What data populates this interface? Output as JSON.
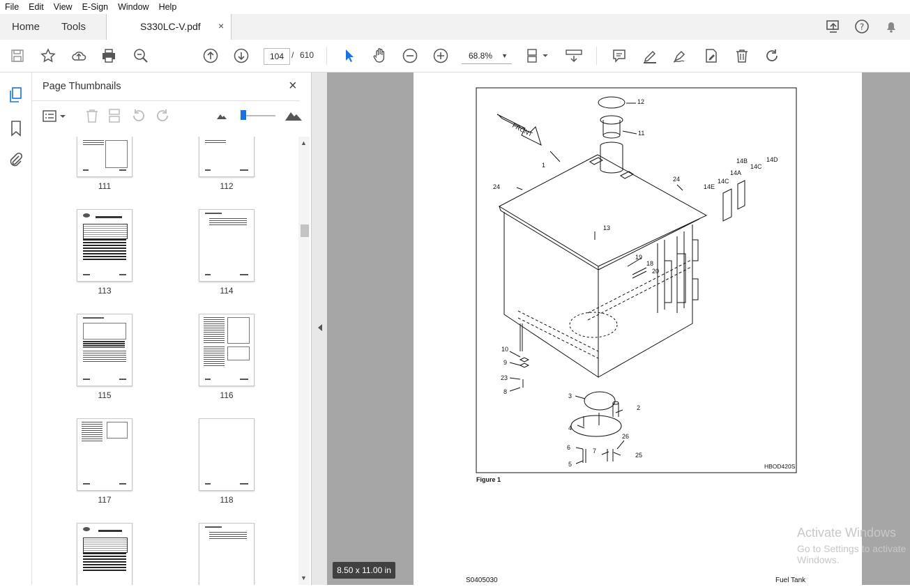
{
  "menu": [
    "File",
    "Edit",
    "View",
    "E-Sign",
    "Window",
    "Help"
  ],
  "tabs": {
    "home": "Home",
    "tools": "Tools",
    "document": "S330LC-V.pdf",
    "close": "×"
  },
  "toolbar": {
    "page_current": "104",
    "page_sep": "/",
    "page_total": "610",
    "zoom": "68.8%"
  },
  "panel": {
    "title": "Page Thumbnails",
    "close": "×",
    "thumbnails": [
      {
        "label": "111"
      },
      {
        "label": "112"
      },
      {
        "label": "113"
      },
      {
        "label": "114"
      },
      {
        "label": "115"
      },
      {
        "label": "116"
      },
      {
        "label": "117"
      },
      {
        "label": "118"
      },
      {
        "label": ""
      },
      {
        "label": ""
      }
    ]
  },
  "document": {
    "page_size": "8.50 x 11.00 in",
    "figure_caption": "Figure 1",
    "figure_code": "HBOD420S",
    "front_label": "FRONT",
    "callouts": [
      "12",
      "11",
      "1",
      "24",
      "24",
      "14B",
      "14D",
      "14A",
      "14C",
      "14C",
      "14E",
      "13",
      "19",
      "18",
      "20",
      "10",
      "9",
      "23",
      "8",
      "3",
      "2",
      "4",
      "26",
      "6",
      "7",
      "25",
      "5"
    ],
    "footer_left": "S0405030",
    "footer_right": "Fuel Tank"
  },
  "watermark": {
    "line1": "Activate Windows",
    "line2": "Go to Settings to activate Windows."
  }
}
